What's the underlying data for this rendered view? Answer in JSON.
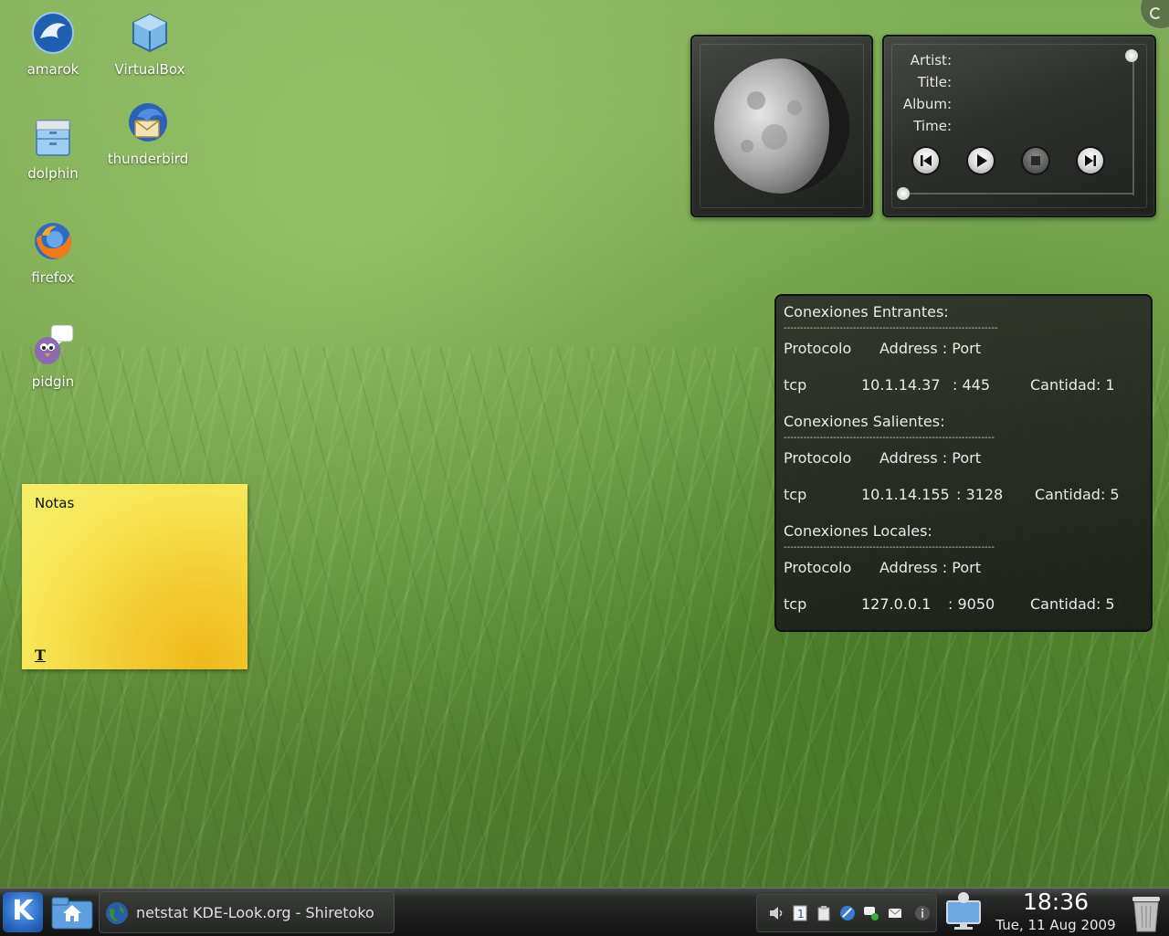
{
  "desktop": {
    "icons": [
      {
        "name": "amarok",
        "icon": "amarok-icon"
      },
      {
        "name": "VirtualBox",
        "icon": "virtualbox-icon"
      },
      {
        "name": "dolphin",
        "icon": "dolphin-icon"
      },
      {
        "name": "thunderbird",
        "icon": "thunderbird-icon"
      },
      {
        "name": "firefox",
        "icon": "firefox-icon"
      },
      {
        "name": "pidgin",
        "icon": "pidgin-icon"
      }
    ]
  },
  "player": {
    "artist_label": "Artist:",
    "title_label": "Title:",
    "album_label": "Album:",
    "time_label": "Time:",
    "buttons": [
      "previous-icon",
      "play-icon",
      "stop-icon",
      "next-icon"
    ]
  },
  "netstat": {
    "incoming": {
      "heading": "Conexiones Entrantes:",
      "separator": "-----------------------------------------------------------------",
      "col_protocol": "Protocolo",
      "col_address": "Address : Port",
      "row": {
        "protocol": "tcp",
        "address": "10.1.14.37",
        "port": ": 445",
        "count": "Cantidad: 1"
      }
    },
    "outgoing": {
      "heading": "Conexiones Salientes:",
      "separator": "----------------------------------------------------------------",
      "col_protocol": "Protocolo",
      "col_address": "Address : Port",
      "row": {
        "protocol": "tcp",
        "address": "10.1.14.155",
        "port": ": 3128",
        "count": "Cantidad: 5"
      }
    },
    "local": {
      "heading": "Conexiones Locales:",
      "separator": "----------------------------------------------------------------",
      "col_protocol": "Protocolo",
      "col_address": "Address : Port",
      "row": {
        "protocol": "tcp",
        "address": "127.0.0.1",
        "port": ": 9050",
        "count": "Cantidad: 5"
      }
    }
  },
  "note": {
    "title": "Notas",
    "format_button": "T"
  },
  "taskbar": {
    "kmenu_label": "K",
    "task": "netstat KDE-Look.org - Shiretoko",
    "clock_time": "18:36",
    "clock_date": "Tue, 11 Aug 2009",
    "tray_icons": [
      "volume-icon",
      "clipboard-number-icon",
      "klipper-icon",
      "network-icon",
      "chat-icon",
      "mail-icon",
      "info-icon"
    ]
  }
}
